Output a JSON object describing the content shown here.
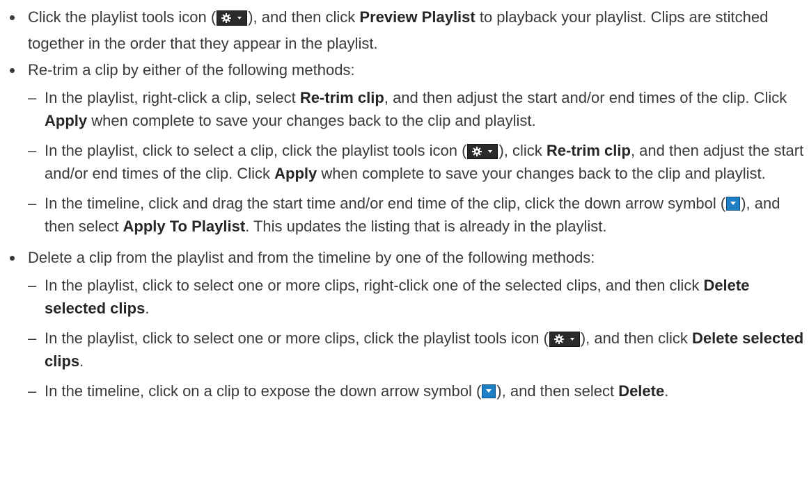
{
  "items": [
    {
      "p1": "Click the playlist tools icon (",
      "p2": "), and then click ",
      "b1": "Preview Playlist",
      "p3": " to playback your playlist. Clips are stitched together in the order that they appear in the playlist."
    },
    {
      "text": "Re-trim a clip by either of the following methods:",
      "subs": [
        {
          "p1": "In the playlist, right-click a clip, select ",
          "b1": "Re-trim clip",
          "p2": ", and then adjust the start and/or end times of the clip. Click ",
          "b2": "Apply",
          "p3": " when complete to save your changes back to the clip and playlist."
        },
        {
          "p1": "In the playlist, click to select a clip, click the playlist tools icon (",
          "p2": "), click ",
          "b1": "Re-trim clip",
          "p3": ", and then adjust the start and/or end times of the clip. Click ",
          "b2": "Apply",
          "p4": " when complete to save your changes back to the clip and playlist."
        },
        {
          "p1": "In the timeline, click and drag the start time and/or end time of the clip, click the down arrow symbol (",
          "p2": "), and then select ",
          "b1": "Apply To Playlist",
          "p3": ". This updates the listing that is already in the playlist."
        }
      ]
    },
    {
      "text": "Delete a clip from the playlist and from the timeline by one of the following methods:",
      "subs": [
        {
          "p1": "In the playlist, click to select one or more clips, right-click one of the selected clips, and then click ",
          "b1": "Delete selected clips",
          "p2": "."
        },
        {
          "p1": "In the playlist, click to select one or more clips, click the playlist tools icon (",
          "p2": "), and then click ",
          "b1": "Delete selected clips",
          "p3": "."
        },
        {
          "p1": "In the timeline, click on a clip to expose the down arrow symbol (",
          "p2": "), and then select ",
          "b1": "Delete",
          "p3": "."
        }
      ]
    }
  ],
  "icons": {
    "gear": "playlist-tools-gear-icon",
    "arrow": "down-arrow-icon"
  },
  "colors": {
    "text": "#3a3a3a",
    "gear_bg": "#2b2b2b",
    "arrow_bg": "#1f7fc4"
  }
}
